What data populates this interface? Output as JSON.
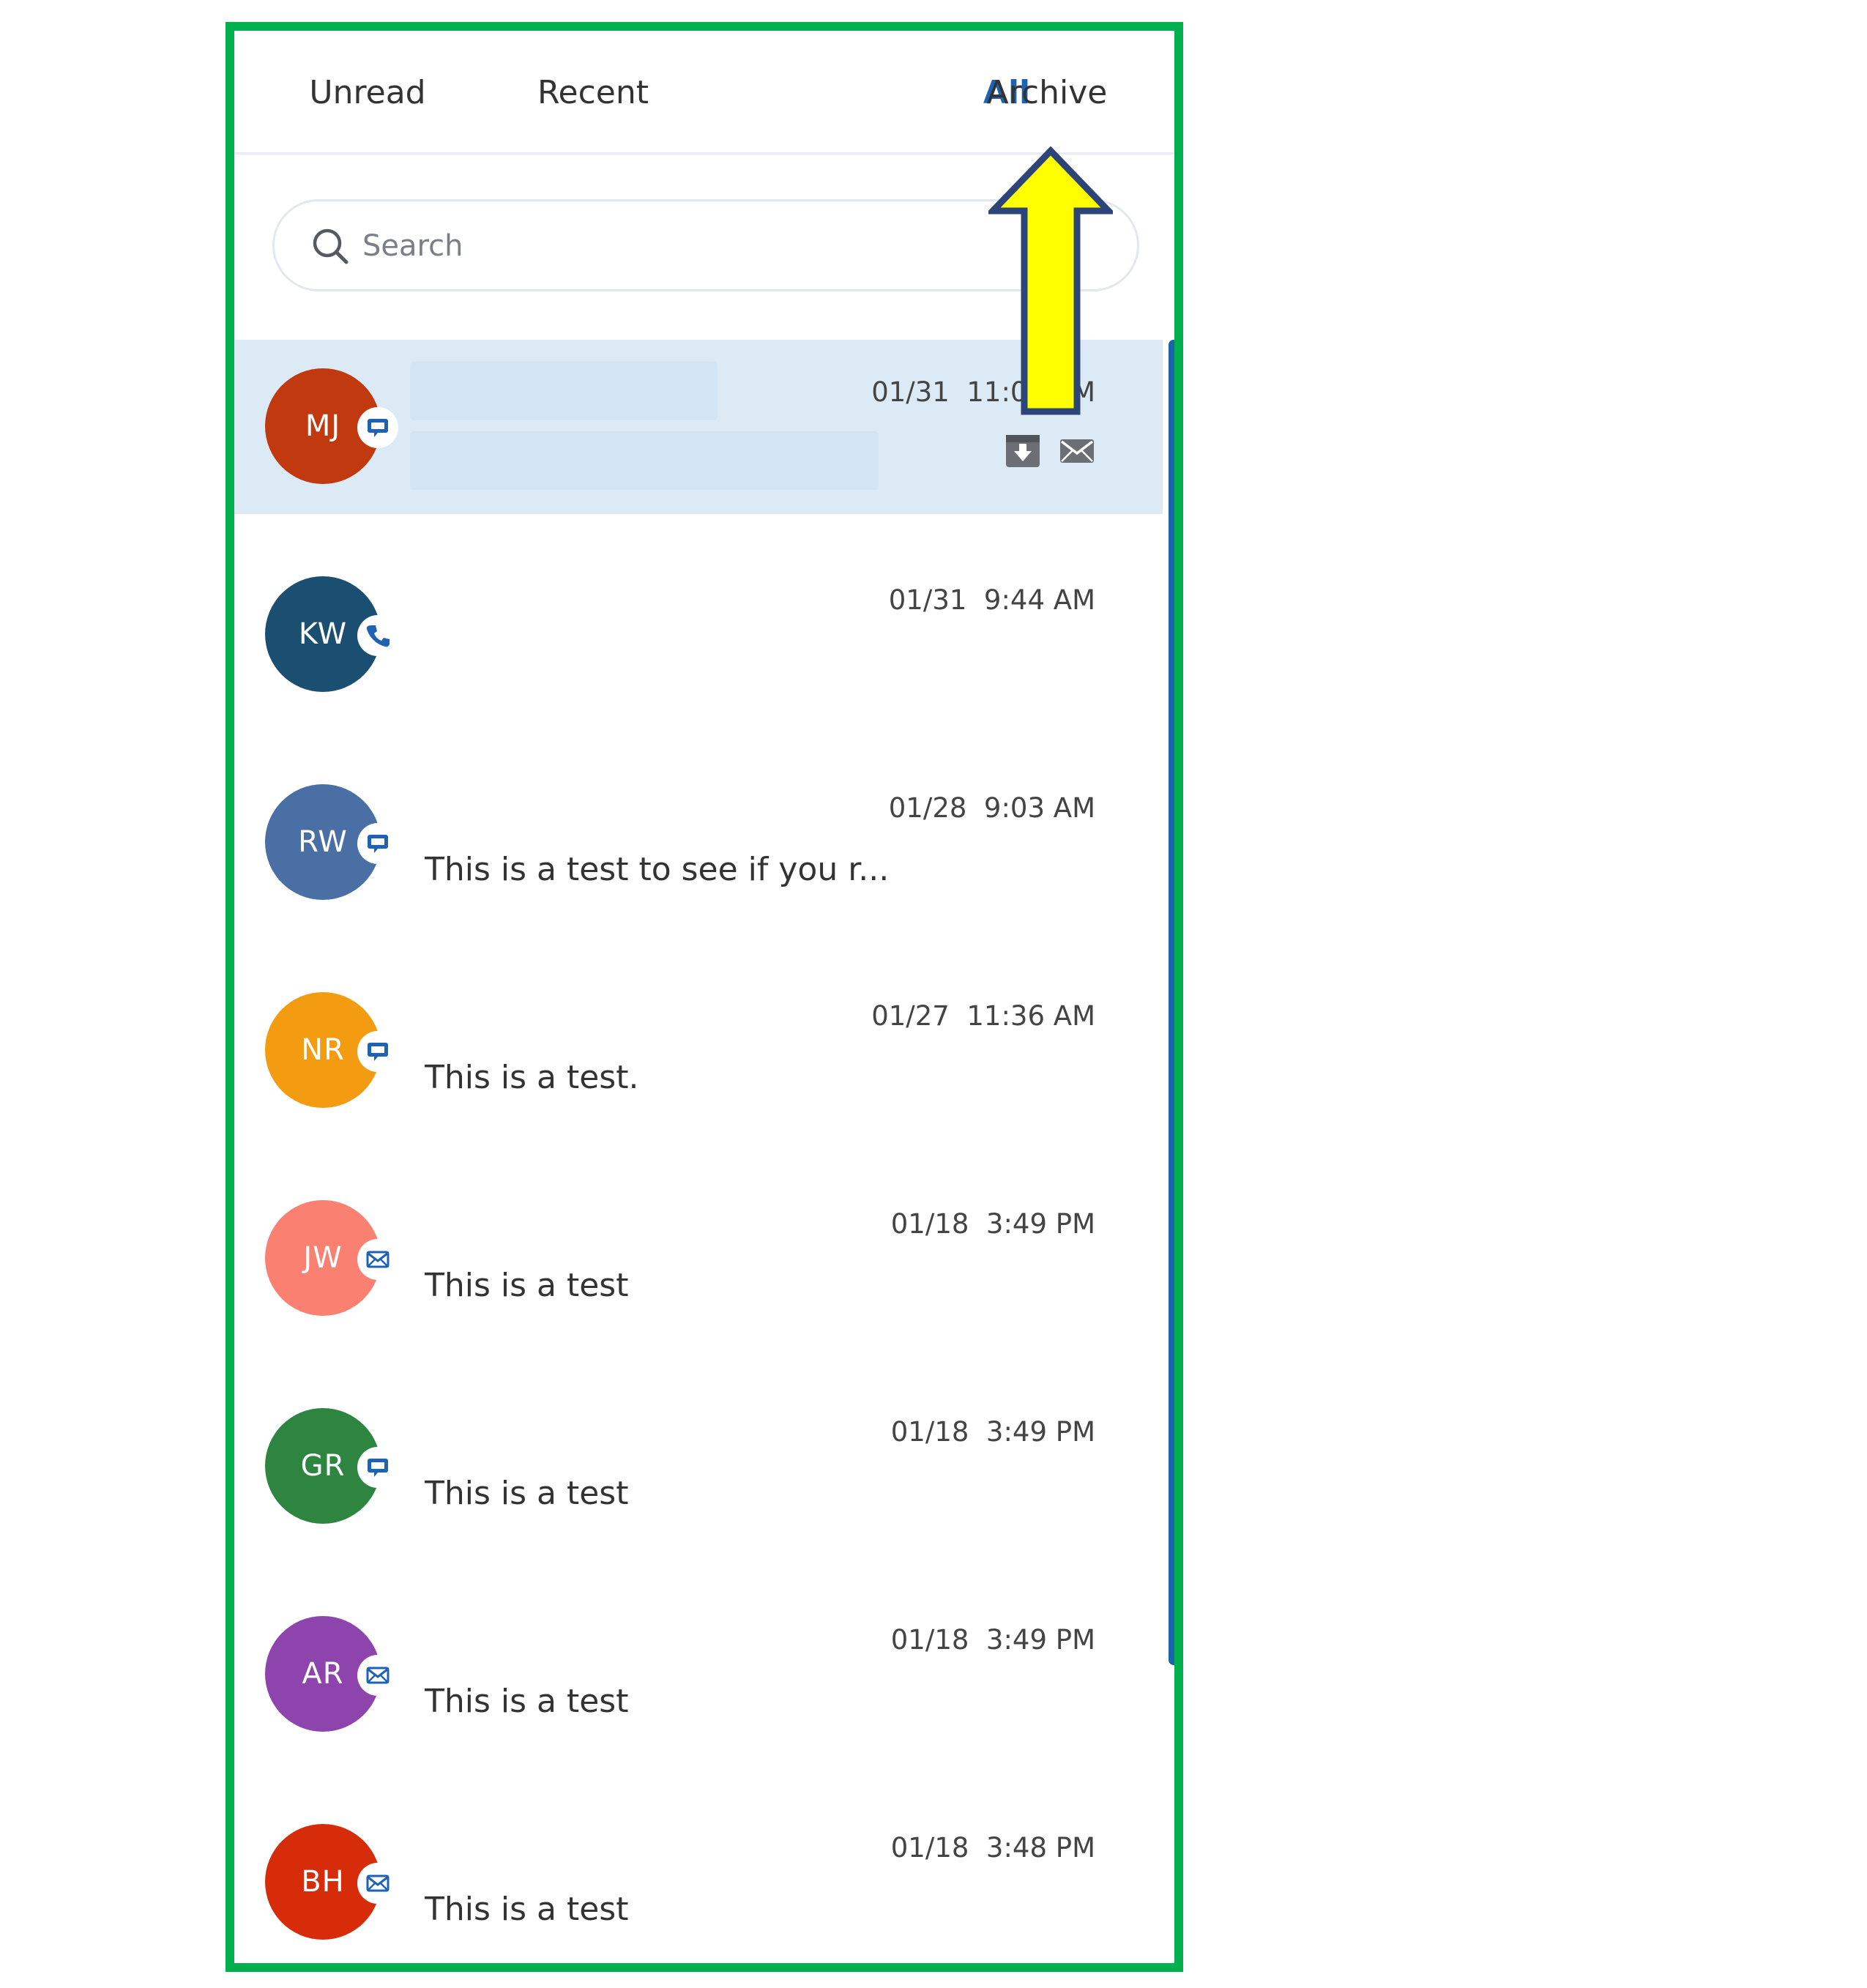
{
  "tabs": [
    {
      "label": "Unread"
    },
    {
      "label": "Recent"
    },
    {
      "label": "All",
      "active": true
    },
    {
      "label": "Archive"
    }
  ],
  "search": {
    "placeholder": "Search",
    "value": ""
  },
  "colors": {
    "frame_border": "#00b04f",
    "active_tab": "#1e63b3",
    "selected_row": "#dbeaf5",
    "scrollbar": "#1c63ae",
    "arrow_fill": "#ffff00",
    "arrow_outline": "#2d4478"
  },
  "conversations": [
    {
      "initials": "MJ",
      "color": "#c0390f",
      "channel": "chat-icon",
      "time": "01/31  11:09 AM",
      "preview": "",
      "selected": true,
      "actions": [
        "archive-icon",
        "mail-icon"
      ]
    },
    {
      "initials": "KW",
      "color": "#1b4f72",
      "channel": "phone-icon",
      "time": "01/31  9:44 AM",
      "preview": ""
    },
    {
      "initials": "RW",
      "color": "#4a6fa5",
      "channel": "chat-icon",
      "time": "01/28  9:03 AM",
      "preview": "This is a test to see if you r..."
    },
    {
      "initials": "NR",
      "color": "#f39c12",
      "channel": "chat-icon",
      "time": "01/27  11:36 AM",
      "preview": "This is a test."
    },
    {
      "initials": "JW",
      "color": "#fa8072",
      "channel": "email-icon",
      "time": "01/18  3:49 PM",
      "preview": "This is a test"
    },
    {
      "initials": "GR",
      "color": "#2e8540",
      "channel": "chat-icon",
      "time": "01/18  3:49 PM",
      "preview": "This is a test"
    },
    {
      "initials": "AR",
      "color": "#8e44ad",
      "channel": "email-icon",
      "time": "01/18  3:49 PM",
      "preview": "This is a test"
    },
    {
      "initials": "BH",
      "color": "#d62c0a",
      "channel": "email-icon",
      "time": "01/18  3:48 PM",
      "preview": "This is a test"
    }
  ]
}
